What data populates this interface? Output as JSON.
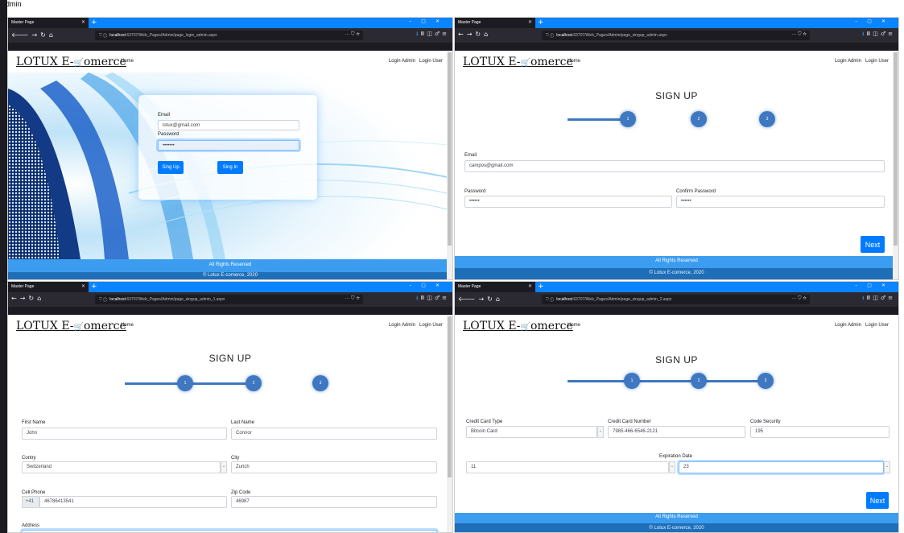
{
  "caption": "admin",
  "windows": [
    {
      "tab_title": "Master Page",
      "url_host": "localhost",
      "url_rest": ":63707/Web_Pages/Admin/page_login_admin.aspx",
      "brand": "LOTUX E-",
      "brand_rest": "omerce",
      "nav_home": "Home",
      "nav_login_admin": "Login Admin",
      "nav_login_user": "Login User",
      "email_label": "Email",
      "email_value": "lotux@gmail.com",
      "password_label": "Password",
      "password_value": "•••••••",
      "signup_button": "Sing Up",
      "signin_button": "Sing In",
      "footer_rights": "All Rights Reserved",
      "footer_copy": "© Lotux E-comerce, 2020"
    },
    {
      "tab_title": "Master Page",
      "url_host": "localhost",
      "url_rest": ":63707/Web_Pages/Admin/page_singup_admin.aspx",
      "brand": "LOTUX E-",
      "brand_rest": "omerce",
      "nav_home": "Home",
      "nav_login_admin": "Login Admin",
      "nav_login_user": "Login User",
      "heading": "SIGN UP",
      "steps": [
        "1",
        "2",
        "3"
      ],
      "email_label": "Email",
      "email_value": "campos@gmail.com",
      "password_label": "Password",
      "password_value": "••••••",
      "confirm_label": "Confirm Password",
      "confirm_value": "••••••",
      "next_button": "Next",
      "footer_rights": "All Rights Reserved",
      "footer_copy": "© Lotux E-comerce, 2020"
    },
    {
      "tab_title": "Master Page",
      "url_host": "localhost",
      "url_rest": ":63707/Web_Pages/Admin/page_singup_admin_1.aspx",
      "brand": "LOTUX E-",
      "brand_rest": "omerce",
      "nav_home": "Home",
      "nav_login_admin": "Login Admin",
      "nav_login_user": "Login User",
      "heading": "SIGN UP",
      "steps": [
        "1",
        "2",
        "3"
      ],
      "first_name_label": "First Name",
      "first_name_value": "John",
      "last_name_label": "Last Name",
      "last_name_value": "Connor",
      "country_label": "Contry",
      "country_value": "Switzerland",
      "city_label": "City",
      "city_value": "Zurich",
      "phone_label": "Cell Phone",
      "phone_prefix": "+41",
      "phone_value": "46786413541",
      "zip_label": "Zip Code",
      "zip_value": "46987",
      "address_label": "Address"
    },
    {
      "tab_title": "Master Page",
      "url_host": "localhost",
      "url_rest": ":63707/Web_Pages/Admin/page_singup_admin_2.aspx",
      "brand": "LOTUX E-",
      "brand_rest": "omerce",
      "nav_home": "Home",
      "nav_login_admin": "Login Admin",
      "nav_login_user": "Login User",
      "heading": "SIGN UP",
      "steps": [
        "1",
        "2",
        "3"
      ],
      "card_type_label": "Credit Card Type",
      "card_type_value": "Bitcoin Card",
      "card_number_label": "Credit Card Number",
      "card_number_value": "7985-466-6546-2121",
      "code_label": "Code Security",
      "code_value": "195",
      "expiration_label": "Expiration Date",
      "exp_month": "11",
      "exp_year": "23",
      "next_button": "Next",
      "footer_rights": "All Rights Reserved",
      "footer_copy": "© Lotux E-comerce, 2020"
    }
  ]
}
